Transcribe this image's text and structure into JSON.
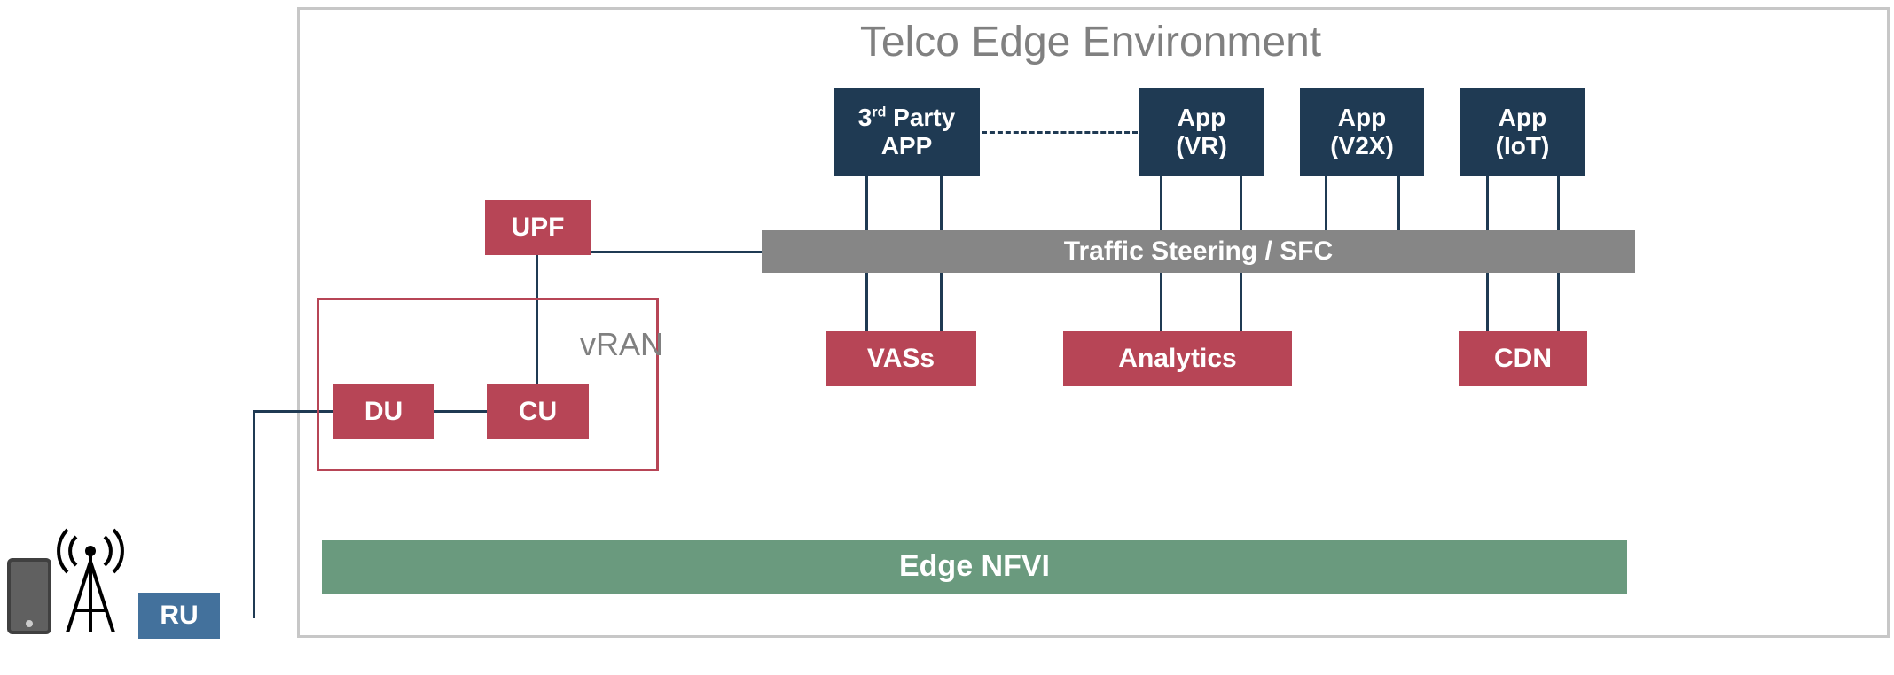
{
  "title": "Telco Edge Environment",
  "vran_label": "vRAN",
  "boxes": {
    "du": "DU",
    "cu": "CU",
    "upf": "UPF",
    "app1_line1_prefix": "3",
    "app1_line1_sup": "rd",
    "app1_line1_suffix": " Party",
    "app1_line2": "APP",
    "app2_l1": "App",
    "app2_l2": "(VR)",
    "app3_l1": "App",
    "app3_l2": "(V2X)",
    "app4_l1": "App",
    "app4_l2": "(IoT)",
    "sfc": "Traffic Steering / SFC",
    "vass": "VASs",
    "analytics": "Analytics",
    "cdn": "CDN",
    "nfvi": "Edge NFVI",
    "ru": "RU"
  }
}
